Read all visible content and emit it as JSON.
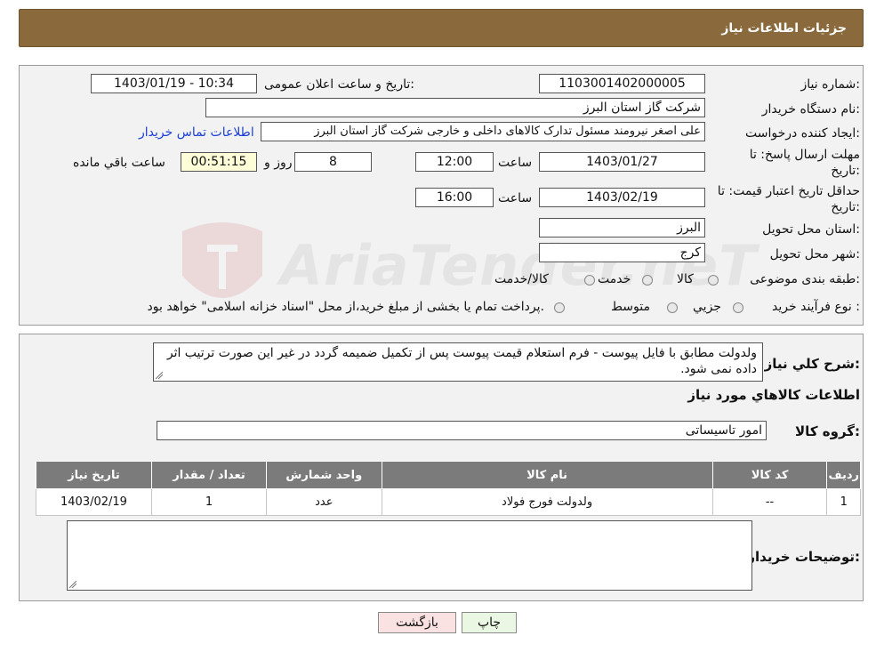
{
  "header": {
    "title": "جزئیات اطلاعات نیاز"
  },
  "fields": {
    "need_number": {
      "label": "شماره نیاز:",
      "value": "1103001402000005"
    },
    "announce_datetime": {
      "label": "تاریخ و ساعت اعلان عمومی:",
      "value": "1403/01/19 - 10:34"
    },
    "buyer_org": {
      "label": "نام دستگاه خریدار:",
      "value": "شرکت گاز استان البرز"
    },
    "requester": {
      "label": "ایجاد کننده درخواست:",
      "value": "علی اصغر نیرومند مسئول تدارک کالاهای داخلی و خارجی شرکت گاز استان البرز",
      "link": "اطلاعات تماس خریدار"
    },
    "deadline": {
      "label_line1": "مهلت ارسال پاسخ: تا",
      "label_line2": "تاریخ:",
      "date": "1403/01/27",
      "time_label": "ساعت",
      "time": "12:00",
      "days": "8",
      "days_label": "روز و",
      "remaining": "00:51:15",
      "remaining_label": "ساعت باقي مانده"
    },
    "validity": {
      "label_line1": "حداقل تاریخ اعتبار قیمت: تا",
      "label_line2": "تاریخ:",
      "date": "1403/02/19",
      "time_label": "ساعت",
      "time": "16:00"
    },
    "province": {
      "label": "استان محل تحویل:",
      "value": "البرز"
    },
    "city": {
      "label": "شهر محل تحویل:",
      "value": "کرج"
    },
    "category": {
      "label": "طبقه بندی موضوعی:",
      "options": [
        "کالا",
        "خدمت",
        "کالا/خدمت"
      ]
    },
    "purchase_type": {
      "label": "نوع فرآیند خرید :",
      "options": [
        "جزیي",
        "متوسط"
      ],
      "note": "پرداخت تمام یا بخشی از مبلغ خرید،از محل \"اسناد خزانه اسلامی\" خواهد بود."
    }
  },
  "description": {
    "label": "شرح کلي نياز:",
    "text": "ولدولت مطابق با فایل پیوست - فرم استعلام قیمت پیوست پس از تکمیل ضمیمه گردد در غیر این صورت ترتیب اثر داده نمی شود."
  },
  "goods_section": {
    "title": "اطلاعات کالاهاي مورد نياز",
    "group_label": "گروه کالا:",
    "group_value": "امور تاسیساتی",
    "columns": [
      "رديف",
      "کد کالا",
      "نام کالا",
      "واحد شمارش",
      "تعداد / مقدار",
      "تاریخ نیاز"
    ],
    "rows": [
      [
        "1",
        "--",
        "ولدولت فورج فولاد",
        "عدد",
        "1",
        "1403/02/19"
      ]
    ]
  },
  "buyer_notes": {
    "label": "توضیحات خریدار:",
    "value": ""
  },
  "buttons": {
    "print": "چاپ",
    "back": "بازگشت"
  },
  "watermark": {
    "text": "AriaTender.neT"
  },
  "colors": {
    "header": "#8a6a3c",
    "print_button": "#eaf7e2",
    "back_button": "#fbe2e2",
    "table_header": "#7b7b7b"
  }
}
